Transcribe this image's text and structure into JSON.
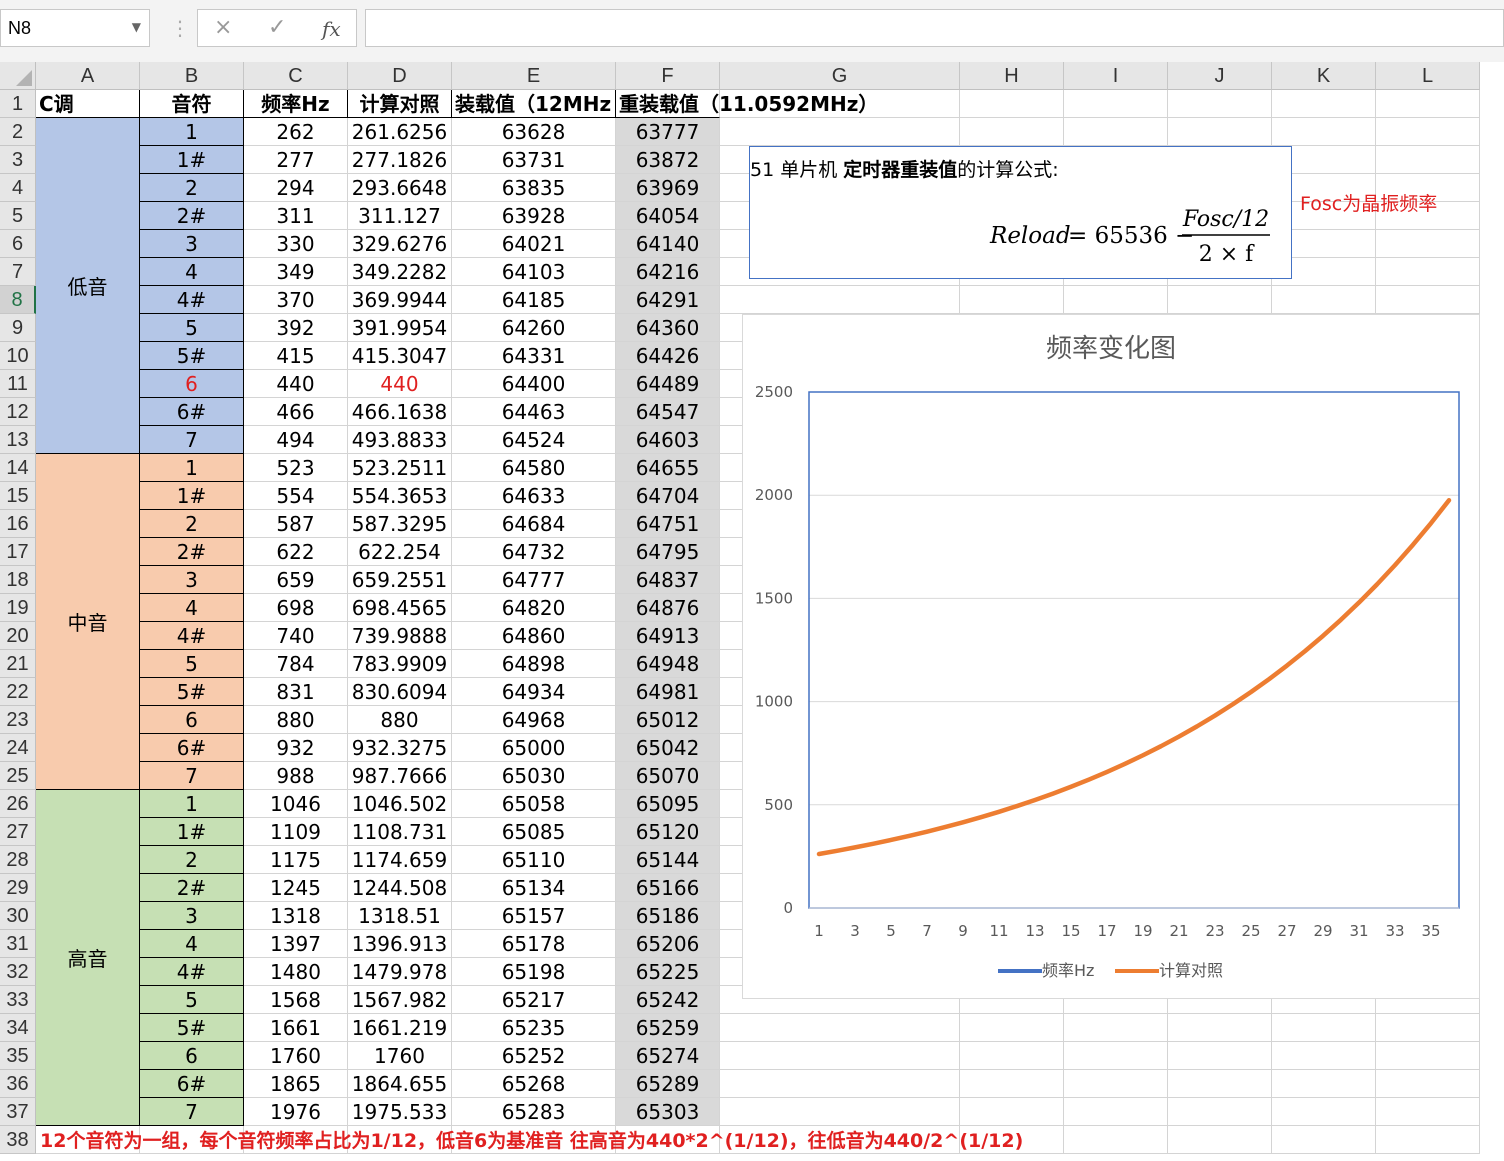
{
  "namebox": "N8",
  "formula_icons": {
    "cancel": "×",
    "enter": "✓",
    "fx": "fx"
  },
  "columns": [
    "A",
    "B",
    "C",
    "D",
    "E",
    "F",
    "G",
    "H",
    "I",
    "J",
    "K",
    "L"
  ],
  "rows": [
    "1",
    "2",
    "3",
    "4",
    "5",
    "6",
    "7",
    "8",
    "9",
    "10",
    "11",
    "12",
    "13",
    "14",
    "15",
    "16",
    "17",
    "18",
    "19",
    "20",
    "21",
    "22",
    "23",
    "24",
    "25",
    "26",
    "27",
    "28",
    "29",
    "30",
    "31",
    "32",
    "33",
    "34",
    "35",
    "36",
    "37",
    "38"
  ],
  "selected_row": "8",
  "header_row": {
    "a": "C调",
    "b": "音符",
    "c": "频率Hz",
    "d": "计算对照",
    "e": "装载值（12MHz",
    "f": "重装载值（11.0592MHz）"
  },
  "groups": [
    {
      "label": "低音",
      "color": "blue"
    },
    {
      "label": "中音",
      "color": "orange"
    },
    {
      "label": "高音",
      "color": "green"
    }
  ],
  "table": [
    [
      "1",
      "262",
      "261.6256",
      "63628",
      "63777"
    ],
    [
      "1#",
      "277",
      "277.1826",
      "63731",
      "63872"
    ],
    [
      "2",
      "294",
      "293.6648",
      "63835",
      "63969"
    ],
    [
      "2#",
      "311",
      "311.127",
      "63928",
      "64054"
    ],
    [
      "3",
      "330",
      "329.6276",
      "64021",
      "64140"
    ],
    [
      "4",
      "349",
      "349.2282",
      "64103",
      "64216"
    ],
    [
      "4#",
      "370",
      "369.9944",
      "64185",
      "64291"
    ],
    [
      "5",
      "392",
      "391.9954",
      "64260",
      "64360"
    ],
    [
      "5#",
      "415",
      "415.3047",
      "64331",
      "64426"
    ],
    [
      "6",
      "440",
      "440",
      "64400",
      "64489"
    ],
    [
      "6#",
      "466",
      "466.1638",
      "64463",
      "64547"
    ],
    [
      "7",
      "494",
      "493.8833",
      "64524",
      "64603"
    ],
    [
      "1",
      "523",
      "523.2511",
      "64580",
      "64655"
    ],
    [
      "1#",
      "554",
      "554.3653",
      "64633",
      "64704"
    ],
    [
      "2",
      "587",
      "587.3295",
      "64684",
      "64751"
    ],
    [
      "2#",
      "622",
      "622.254",
      "64732",
      "64795"
    ],
    [
      "3",
      "659",
      "659.2551",
      "64777",
      "64837"
    ],
    [
      "4",
      "698",
      "698.4565",
      "64820",
      "64876"
    ],
    [
      "4#",
      "740",
      "739.9888",
      "64860",
      "64913"
    ],
    [
      "5",
      "784",
      "783.9909",
      "64898",
      "64948"
    ],
    [
      "5#",
      "831",
      "830.6094",
      "64934",
      "64981"
    ],
    [
      "6",
      "880",
      "880",
      "64968",
      "65012"
    ],
    [
      "6#",
      "932",
      "932.3275",
      "65000",
      "65042"
    ],
    [
      "7",
      "988",
      "987.7666",
      "65030",
      "65070"
    ],
    [
      "1",
      "1046",
      "1046.502",
      "65058",
      "65095"
    ],
    [
      "1#",
      "1109",
      "1108.731",
      "65085",
      "65120"
    ],
    [
      "2",
      "1175",
      "1174.659",
      "65110",
      "65144"
    ],
    [
      "2#",
      "1245",
      "1244.508",
      "65134",
      "65166"
    ],
    [
      "3",
      "1318",
      "1318.51",
      "65157",
      "65186"
    ],
    [
      "4",
      "1397",
      "1396.913",
      "65178",
      "65206"
    ],
    [
      "4#",
      "1480",
      "1479.978",
      "65198",
      "65225"
    ],
    [
      "5",
      "1568",
      "1567.982",
      "65217",
      "65242"
    ],
    [
      "5#",
      "1661",
      "1661.219",
      "65235",
      "65259"
    ],
    [
      "6",
      "1760",
      "1760",
      "65252",
      "65274"
    ],
    [
      "6#",
      "1865",
      "1864.655",
      "65268",
      "65289"
    ],
    [
      "7",
      "1976",
      "1975.533",
      "65283",
      "65303"
    ]
  ],
  "red_row_index": 9,
  "note_row38": "12个音符为一组，每个音符频率占比为1/12，低音6为基准音 往高音为440*2^(1/12)，往低音为440/2^(1/12)",
  "formula_box": {
    "title_pre": "51 单片机 ",
    "title_bold": "定时器重装值",
    "title_post": "的计算公式:",
    "lhs": "Reload",
    "eq": "= 65536 −",
    "numerator": "Fosc/12",
    "denominator": "2 × f"
  },
  "fosc_note": "Fosc为晶振频率",
  "colors": {
    "blue_group": "#b4c6e7",
    "orange_group": "#f8cbad",
    "green_group": "#c6e0b4",
    "grey_col": "#d9d9d9",
    "red_text": "#e02020",
    "series_blue": "#4472c4",
    "series_orange": "#ed7d31"
  },
  "chart_data": {
    "type": "line",
    "title": "频率变化图",
    "ylim": [
      0,
      2500
    ],
    "yticks": [
      "0",
      "500",
      "1000",
      "1500",
      "2000",
      "2500"
    ],
    "xticks": [
      "1",
      "3",
      "5",
      "7",
      "9",
      "11",
      "13",
      "15",
      "17",
      "19",
      "21",
      "23",
      "25",
      "27",
      "29",
      "31",
      "33",
      "35"
    ],
    "x": [
      1,
      2,
      3,
      4,
      5,
      6,
      7,
      8,
      9,
      10,
      11,
      12,
      13,
      14,
      15,
      16,
      17,
      18,
      19,
      20,
      21,
      22,
      23,
      24,
      25,
      26,
      27,
      28,
      29,
      30,
      31,
      32,
      33,
      34,
      35,
      36
    ],
    "grid": true,
    "legend_position": "bottom",
    "series": [
      {
        "name": "频率Hz",
        "color": "#4472c4",
        "values": [
          262,
          277,
          294,
          311,
          330,
          349,
          370,
          392,
          415,
          440,
          466,
          494,
          523,
          554,
          587,
          622,
          659,
          698,
          740,
          784,
          831,
          880,
          932,
          988,
          1046,
          1109,
          1175,
          1245,
          1318,
          1397,
          1480,
          1568,
          1661,
          1760,
          1865,
          1976
        ]
      },
      {
        "name": "计算对照",
        "color": "#ed7d31",
        "values": [
          261.6256,
          277.1826,
          293.6648,
          311.127,
          329.6276,
          349.2282,
          369.9944,
          391.9954,
          415.3047,
          440,
          466.1638,
          493.8833,
          523.2511,
          554.3653,
          587.3295,
          622.254,
          659.2551,
          698.4565,
          739.9888,
          783.9909,
          830.6094,
          880,
          932.3275,
          987.7666,
          1046.502,
          1108.731,
          1174.659,
          1244.508,
          1318.51,
          1396.913,
          1479.978,
          1567.982,
          1661.219,
          1760,
          1864.655,
          1975.533
        ]
      }
    ]
  }
}
